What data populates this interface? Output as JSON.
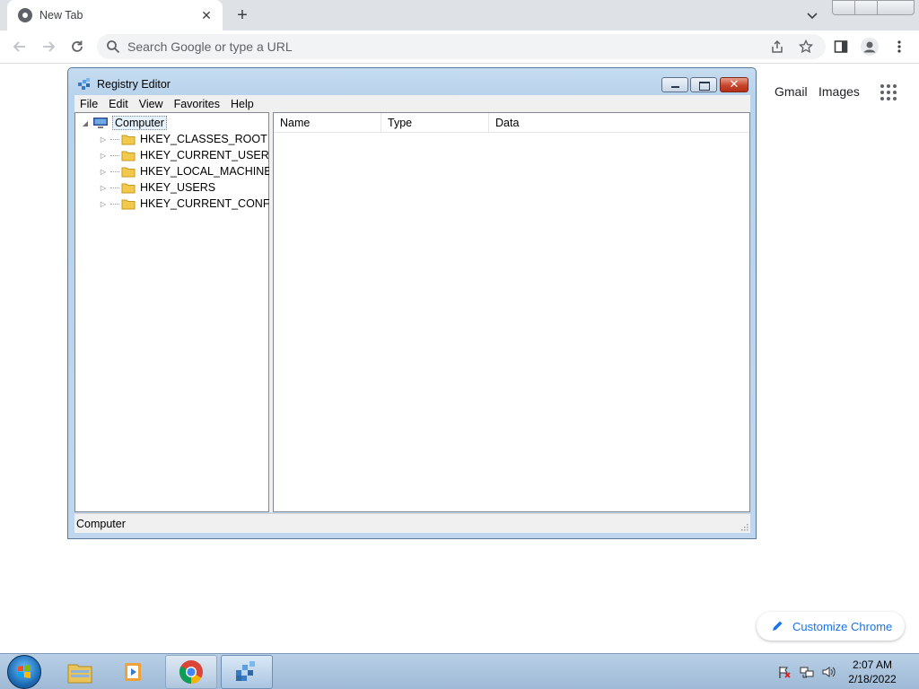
{
  "browser": {
    "tab_title": "New Tab",
    "omnibox_placeholder": "Search Google or type a URL"
  },
  "ntp": {
    "gmail": "Gmail",
    "images": "Images",
    "customize": "Customize Chrome"
  },
  "regedit": {
    "title": "Registry Editor",
    "menu": [
      "File",
      "Edit",
      "View",
      "Favorites",
      "Help"
    ],
    "tree_root": "Computer",
    "hives": [
      "HKEY_CLASSES_ROOT",
      "HKEY_CURRENT_USER",
      "HKEY_LOCAL_MACHINE",
      "HKEY_USERS",
      "HKEY_CURRENT_CONFIG"
    ],
    "columns": [
      "Name",
      "Type",
      "Data"
    ],
    "status": "Computer"
  },
  "taskbar": {
    "time": "2:07 AM",
    "date": "2/18/2022"
  },
  "colors": {
    "accent_blue": "#1a73e8",
    "close_red": "#c8442a",
    "folder_yellow": "#f2c94c"
  }
}
